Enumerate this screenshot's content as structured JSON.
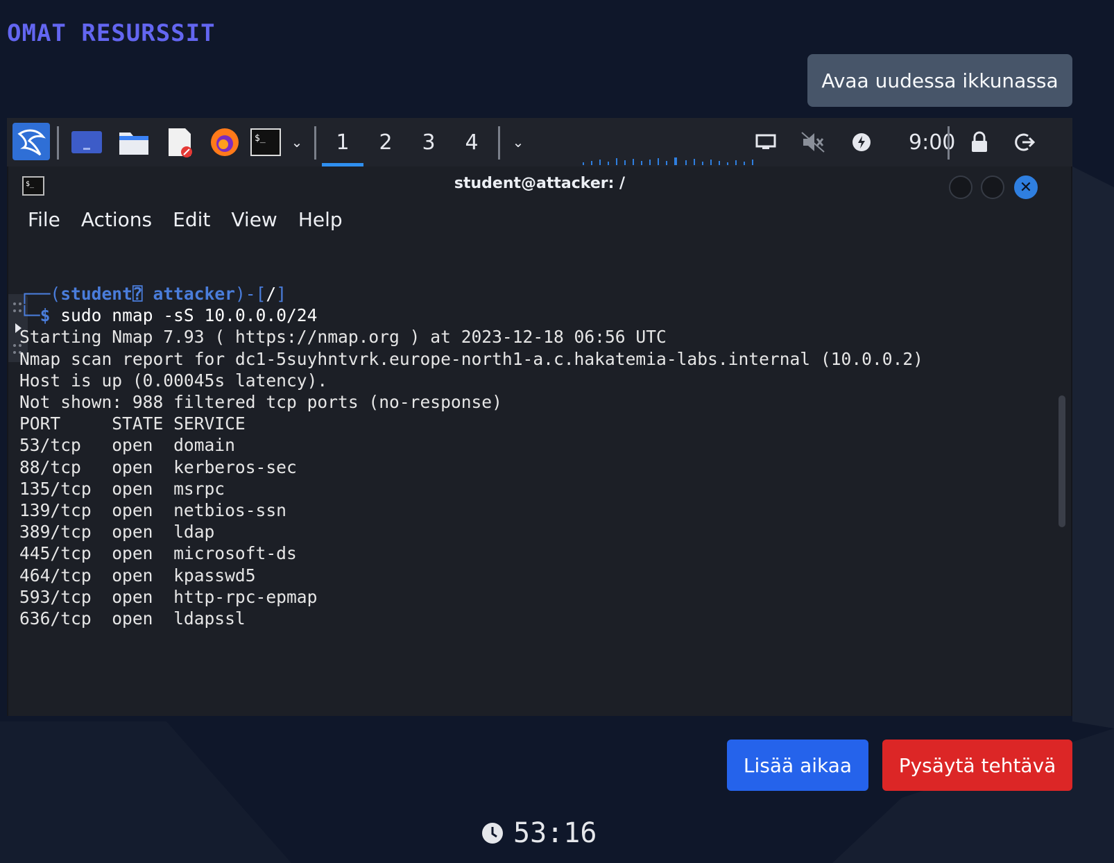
{
  "page": {
    "title": "OMAT RESURSSIT",
    "open_new_window_label": "Avaa uudessa ikkunassa",
    "add_time_label": "Lisää aikaa",
    "stop_task_label": "Pysäytä tehtävä",
    "timer": "53:16"
  },
  "panel": {
    "workspaces": [
      "1",
      "2",
      "3",
      "4"
    ],
    "active_workspace": "1",
    "clock": "9:00",
    "icons": [
      "kali-menu-icon",
      "desktop-icon",
      "file-manager-icon",
      "text-editor-icon",
      "firefox-icon",
      "terminal-icon",
      "dropdown-icon",
      "network-icon",
      "muted-speaker-icon",
      "power-icon",
      "lock-icon",
      "logout-icon"
    ]
  },
  "terminal": {
    "title": "student@attacker: /",
    "menu": [
      "File",
      "Actions",
      "Edit",
      "View",
      "Help"
    ],
    "prompt_user": "student",
    "prompt_glyph": "⍰",
    "prompt_host": "attacker",
    "prompt_path": "/",
    "command": "sudo nmap -sS 10.0.0.0/24",
    "output": [
      "Starting Nmap 7.93 ( https://nmap.org ) at 2023-12-18 06:56 UTC",
      "Nmap scan report for dc1-5suyhntvrk.europe-north1-a.c.hakatemia-labs.internal (10.0.0.2)",
      "Host is up (0.00045s latency).",
      "Not shown: 988 filtered tcp ports (no-response)"
    ],
    "table_header": [
      "PORT",
      "STATE",
      "SERVICE"
    ],
    "ports": [
      {
        "port": "53/tcp",
        "state": "open",
        "service": "domain"
      },
      {
        "port": "88/tcp",
        "state": "open",
        "service": "kerberos-sec"
      },
      {
        "port": "135/tcp",
        "state": "open",
        "service": "msrpc"
      },
      {
        "port": "139/tcp",
        "state": "open",
        "service": "netbios-ssn"
      },
      {
        "port": "389/tcp",
        "state": "open",
        "service": "ldap"
      },
      {
        "port": "445/tcp",
        "state": "open",
        "service": "microsoft-ds"
      },
      {
        "port": "464/tcp",
        "state": "open",
        "service": "kpasswd5"
      },
      {
        "port": "593/tcp",
        "state": "open",
        "service": "http-rpc-epmap"
      },
      {
        "port": "636/tcp",
        "state": "open",
        "service": "ldapssl"
      }
    ]
  },
  "colors": {
    "page_bg": "#0f172a",
    "title": "#6366f1",
    "add_time": "#2563eb",
    "stop_task": "#dc2626",
    "prompt": "#4a7ddb",
    "panel_bg": "#20232b"
  }
}
